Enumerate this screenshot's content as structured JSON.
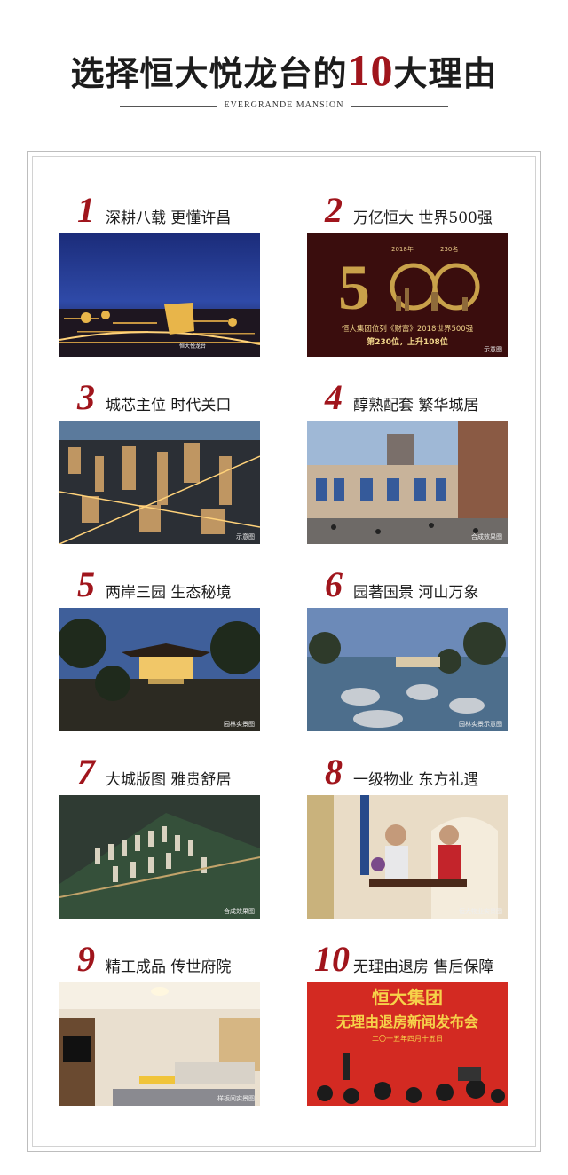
{
  "header": {
    "title_pre": "选择恒大悦龙台的",
    "title_num": "10",
    "title_post": "大理由",
    "subtitle": "EVERGRANDE MANSION"
  },
  "reasons": [
    {
      "num": "1",
      "caption": "深耕八载  更懂许昌",
      "photo": "night-city-logo-photo",
      "note": ""
    },
    {
      "num": "2",
      "caption": "万亿恒大  世界500强",
      "photo": "fortune-500-graphic",
      "overlay": {
        "top_left": "2018年",
        "top_right": "230名",
        "line1": "恒大集团位列《财富》2018世界500强",
        "line2": "第230位，上升108位"
      },
      "note": "示意图"
    },
    {
      "num": "3",
      "caption": "城芯主位  时代关口",
      "photo": "aerial-city-photo",
      "note": "示意图"
    },
    {
      "num": "4",
      "caption": "醇熟配套  繁华城居",
      "photo": "shopping-plaza-photo",
      "note": "合成效果图"
    },
    {
      "num": "5",
      "caption": "两岸三园  生态秘境",
      "photo": "pavilion-garden-photo",
      "note": "园林实景图"
    },
    {
      "num": "6",
      "caption": "园著国景  河山万象",
      "photo": "rock-stream-garden-photo",
      "note": "园林实景示意图"
    },
    {
      "num": "7",
      "caption": "大城版图  雅贵舒居",
      "photo": "masterplan-aerial-render",
      "note": "合成效果图"
    },
    {
      "num": "8",
      "caption": "一级物业  东方礼遇",
      "photo": "property-service-photo",
      "note": "恒大物业实景图"
    },
    {
      "num": "9",
      "caption": "精工成品  传世府院",
      "photo": "living-room-photo",
      "note": "样板间实景图"
    },
    {
      "num": "10",
      "caption": "无理由退房  售后保障",
      "photo": "press-conference-photo",
      "overlay": {
        "line1": "恒大集团",
        "line2": "无理由退房新闻发布会",
        "line3": "二〇一五年四月十五日"
      },
      "note": ""
    }
  ],
  "colors": {
    "accent": "#a0151c",
    "text": "#1c1c1c",
    "frame": "#bdbdbd"
  }
}
